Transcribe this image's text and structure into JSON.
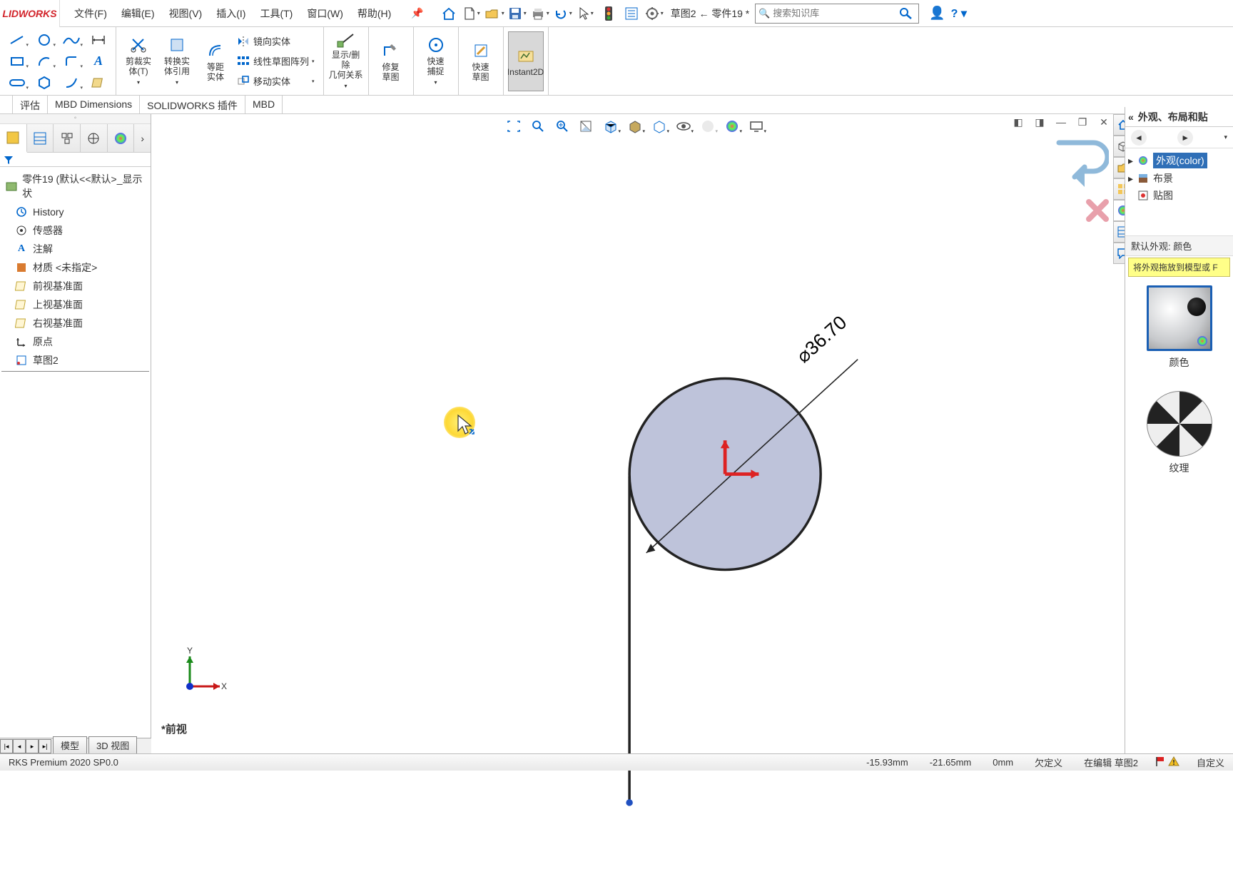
{
  "app": {
    "logo": "LIDWORKS"
  },
  "menu": {
    "file": "文件(F)",
    "edit": "编辑(E)",
    "view": "视图(V)",
    "insert": "插入(I)",
    "tools": "工具(T)",
    "window": "窗口(W)",
    "help": "帮助(H)"
  },
  "docname": "草图2 ← 零件19 *",
  "search": {
    "placeholder": "搜索知识库"
  },
  "ribbon": {
    "trim": "剪裁实\n体(T)",
    "convert": "转换实\n体引用",
    "offset": "等距\n实体",
    "mirror": "镜向实体",
    "linear": "线性草图阵列",
    "move": "移动实体",
    "relations": "显示/删除\n几何关系",
    "repair": "修复\n草图",
    "snap": "快速\n捕捉",
    "rapid": "快速\n草图",
    "instant2d": "Instant2D"
  },
  "cmdtabs": {
    "eval": "评估",
    "mbdD": "MBD Dimensions",
    "plugins": "SOLIDWORKS 插件",
    "mbd": "MBD"
  },
  "tree": {
    "root": "零件19  (默认<<默认>_显示状",
    "history": "History",
    "sensors": "传感器",
    "annot": "注解",
    "material": "材质 <未指定>",
    "front": "前视基准面",
    "top": "上视基准面",
    "right": "右视基准面",
    "origin": "原点",
    "sketch": "草图2"
  },
  "rpanel": {
    "title": "外观、布局和贴",
    "appearance": "外观(color)",
    "scene": "布景",
    "decal": "贴图",
    "caption": "默认外观: 颜色",
    "tip": "将外观拖放到模型或 F",
    "thumb1": "颜色",
    "thumb2": "纹理"
  },
  "chart_data": {
    "type": "sketch",
    "dimension_label": "⌀36.70",
    "circle_diameter": 36.7,
    "view_label": "*前视",
    "triad": {
      "x": "X",
      "y": "Y"
    }
  },
  "btabs": {
    "model": "模型",
    "view3d": "3D 视图"
  },
  "status": {
    "product": "RKS Premium 2020 SP0.0",
    "x": "-15.93mm",
    "y": "-21.65mm",
    "z": "0mm",
    "def": "欠定义",
    "editing": "在编辑 草图2",
    "custom": "自定义"
  }
}
